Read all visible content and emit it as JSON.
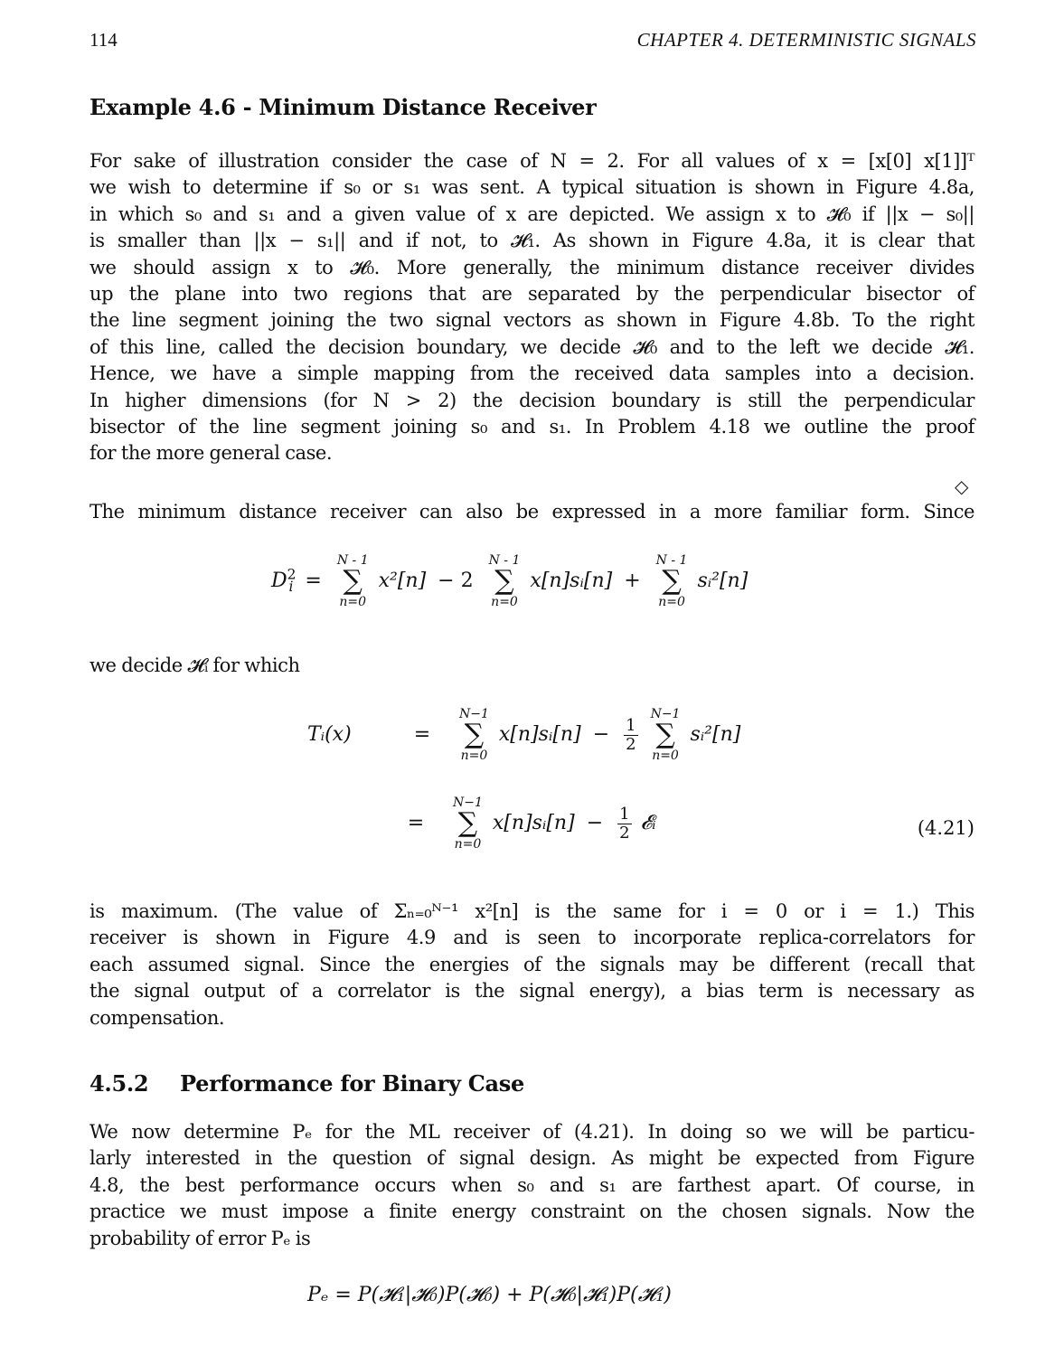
{
  "header": {
    "page_number": "114",
    "chapter_title": "CHAPTER 4.  DETERMINISTIC SIGNALS"
  },
  "example": {
    "title": "Example 4.6 - Minimum Distance Receiver",
    "end_marker": "◇"
  },
  "paragraph1_lines": [
    "For sake of illustration consider the case of N = 2. For all values of x = [x[0] x[1]]ᵀ",
    "we wish to determine if s₀ or s₁ was sent. A typical situation is shown in Figure 4.8a,",
    "in which s₀ and s₁ and a given value of x are depicted. We assign x to 𝓗₀ if ||x − s₀||",
    "is smaller than ||x − s₁|| and if not, to 𝓗₁. As shown in Figure 4.8a, it is clear that",
    "we should assign x to 𝓗₀. More generally, the minimum distance receiver divides",
    "up the plane into two regions that are separated by the perpendicular bisector of",
    "the line segment joining the two signal vectors as shown in Figure 4.8b. To the right",
    "of this line, called the decision boundary, we decide 𝓗₀ and to the left we decide 𝓗₁.",
    "Hence, we have a simple mapping from the received data samples into a decision.",
    "In higher dimensions (for N > 2) the decision boundary is still the perpendicular",
    "bisector of the line segment joining s₀ and s₁. In Problem 4.18 we outline the proof",
    "for the more general case."
  ],
  "paragraph2": "The minimum distance receiver can also be expressed in a more familiar form. Since",
  "equation_D": {
    "lhs": "D",
    "lhs_sub": "i",
    "lhs_sup": "2",
    "sum_upper": "N - 1",
    "sum_lower": "n=0",
    "term1": "x²[n]",
    "op1": "− 2",
    "term2": "x[n]sᵢ[n]",
    "op2": "+",
    "term3": "sᵢ²[n]"
  },
  "paragraph3": "we decide 𝓗ᵢ for which",
  "equation_T": {
    "lhs": "Tᵢ(x)",
    "eq": "=",
    "sum_upper": "N−1",
    "sum_lower": "n=0",
    "line1_term1": "x[n]sᵢ[n]",
    "minus": "−",
    "half_num": "1",
    "half_den": "2",
    "line1_term2": "sᵢ²[n]",
    "line2_term1": "x[n]sᵢ[n]",
    "line2_term2": "𝓔ᵢ",
    "number": "(4.21)"
  },
  "paragraph4_lines": [
    "is maximum. (The value of Σₙ₌₀ᴺ⁻¹ x²[n] is the same for i = 0 or i = 1.) This",
    "receiver is shown in Figure 4.9 and is seen to incorporate replica-correlators for",
    "each assumed signal. Since the energies of the signals may be different (recall that",
    "the signal output of a correlator is the signal energy), a bias term is necessary as",
    "compensation."
  ],
  "section": {
    "number": "4.5.2",
    "title": "Performance for Binary Case"
  },
  "paragraph5_lines": [
    "We now determine Pₑ for the ML receiver of (4.21). In doing so we will be particu-",
    "larly interested in the question of signal design. As might be expected from Figure",
    "4.8, the best performance occurs when s₀ and s₁ are farthest apart. Of course, in",
    "practice we must impose a finite energy constraint on the chosen signals. Now the",
    "probability of error Pₑ is"
  ],
  "equation_Pe": "Pₑ = P(𝓗₁|𝓗₀)P(𝓗₀) + P(𝓗₀|𝓗₁)P(𝓗₁)"
}
